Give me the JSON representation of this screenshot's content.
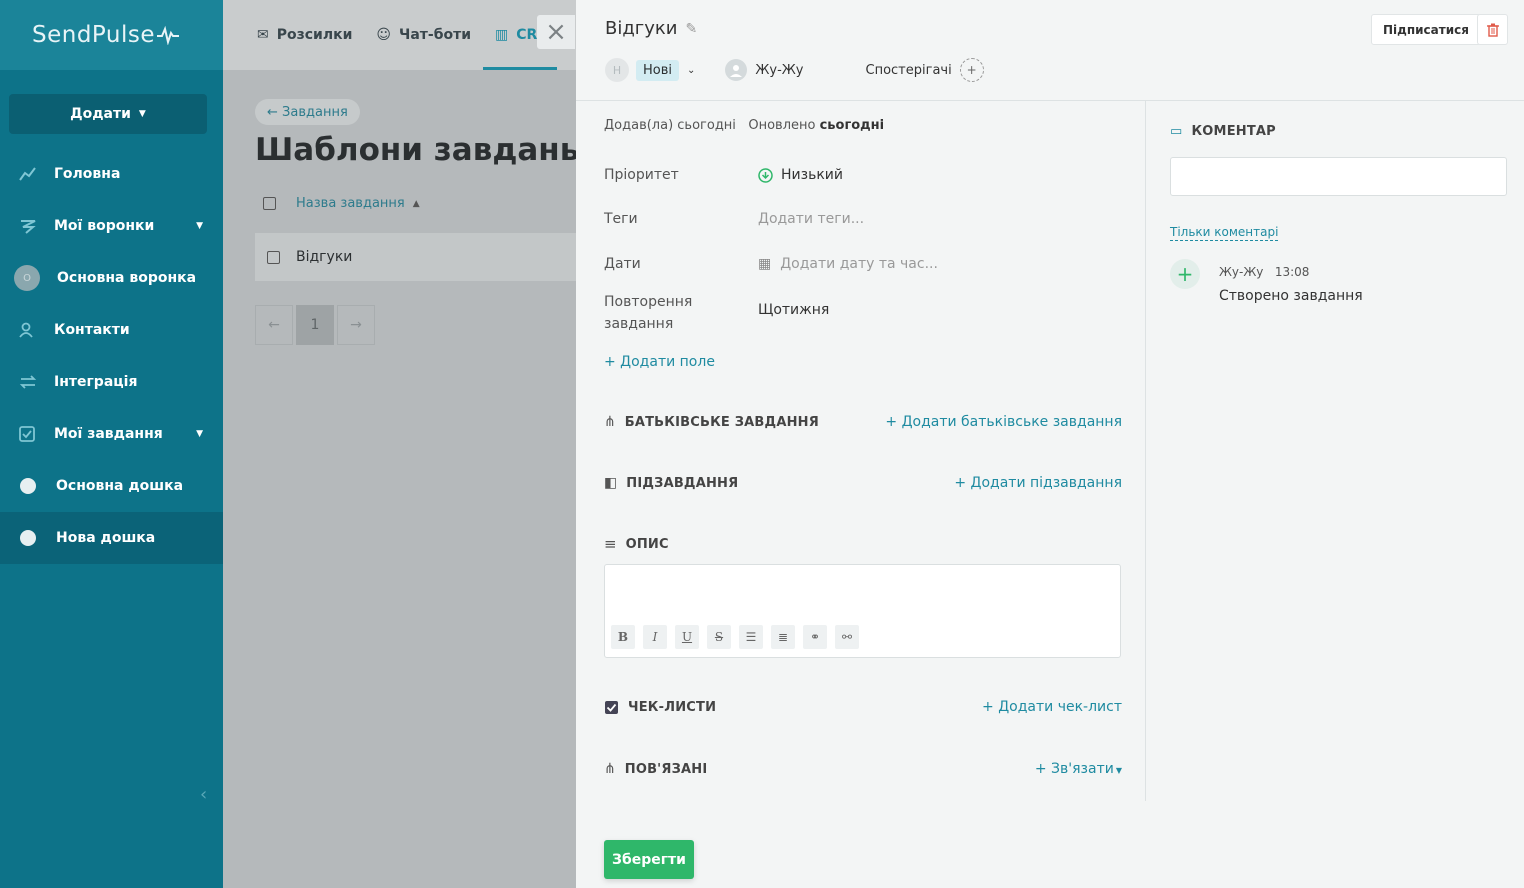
{
  "sidebar": {
    "logo": "SendPulse",
    "add_label": "Додати",
    "items": [
      {
        "label": "Головна"
      },
      {
        "label": "Мої воронки"
      },
      {
        "label": "Основна воронка"
      },
      {
        "label": "Контакти"
      },
      {
        "label": "Інтеграція"
      },
      {
        "label": "Мої завдання"
      },
      {
        "label": "Основна дошка"
      },
      {
        "label": "Нова дошка"
      }
    ],
    "funnel_avatar": "О"
  },
  "topnav": {
    "items": [
      {
        "label": "Розсилки"
      },
      {
        "label": "Чат-боти"
      },
      {
        "label": "CR"
      }
    ]
  },
  "main": {
    "breadcrumb": "← Завдання",
    "title": "Шаблони завдань",
    "column_header": "Назва завдання",
    "rows": [
      {
        "name": "Відгуки"
      }
    ],
    "pager": {
      "prev": "←",
      "current": "1",
      "next": "→"
    }
  },
  "panel": {
    "title": "Відгуки",
    "subscribe_label": "Підписатися",
    "status_avatar": "Н",
    "status": "Нові",
    "assignee": "Жу-Жу",
    "watchers_label": "Спостерігачі",
    "meta_added": "Додав(ла) сьогодні",
    "meta_updated_prefix": "Оновлено",
    "meta_updated_value": "сьогодні",
    "fields": {
      "priority_label": "Пріоритет",
      "priority_value": "Низький",
      "tags_label": "Теги",
      "tags_placeholder": "Додати теги...",
      "dates_label": "Дати",
      "dates_placeholder": "Додати дату та час...",
      "repeat_label_1": "Повторення",
      "repeat_label_2": "завдання",
      "repeat_value": "Щотижня",
      "add_field": "+ Додати поле"
    },
    "sections": {
      "parent_title": "БАТЬКІВСЬКЕ ЗАВДАННЯ",
      "parent_action": "+ Додати батьківське завдання",
      "subtasks_title": "ПІДЗАВДАННЯ",
      "subtasks_action": "+ Додати підзавдання",
      "description_title": "ОПИС",
      "checklists_title": "ЧЕК-ЛИСТИ",
      "checklists_action": "+ Додати чек-лист",
      "related_title": "ПОВ'ЯЗАНІ",
      "related_action": "+ Зв'язати"
    },
    "editor_toolbar": [
      "B",
      "I",
      "U",
      "S"
    ],
    "save_label": "Зберегти",
    "comments": {
      "title": "КОМЕНТАР",
      "only_comments": "Тільки коментарі",
      "activity_author": "Жу-Жу",
      "activity_time": "13:08",
      "activity_text": "Створено завдання"
    }
  },
  "colors": {
    "sidebar": "#0d7389",
    "accent": "#1f8ba1",
    "save": "#2fb76a",
    "delete": "#e05a4a"
  }
}
